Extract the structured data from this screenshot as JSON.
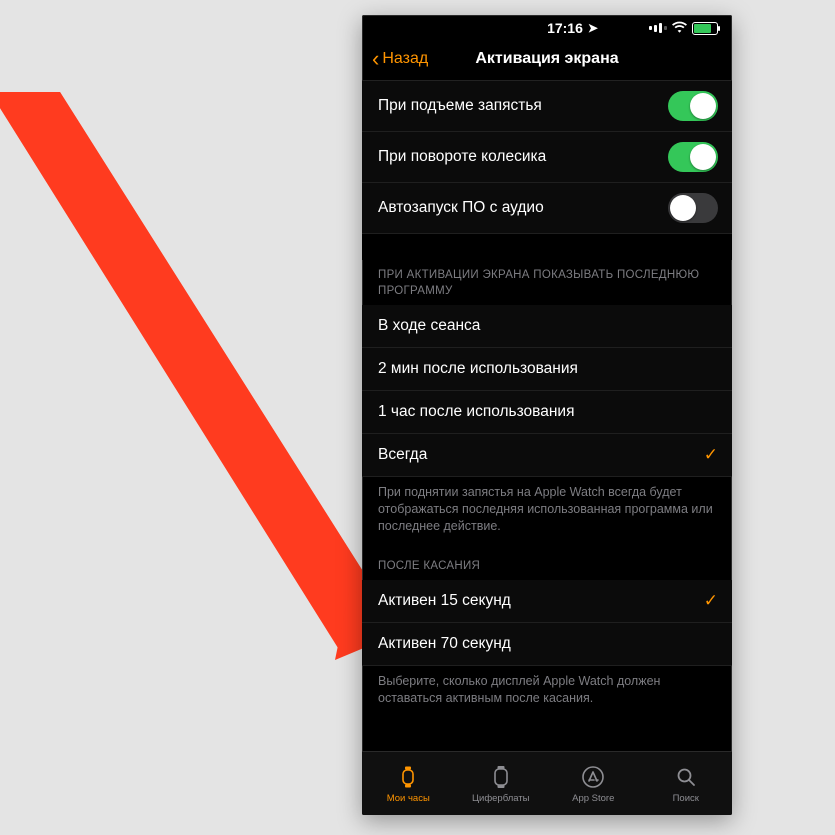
{
  "status": {
    "time": "17:16"
  },
  "nav": {
    "back_label": "Назад",
    "title": "Активация экрана"
  },
  "toggles": [
    {
      "label": "При подъеме запястья",
      "on": true
    },
    {
      "label": "При повороте колесика",
      "on": true
    },
    {
      "label": "Автозапуск ПО с аудио",
      "on": false
    }
  ],
  "section1": {
    "header": "ПРИ АКТИВАЦИИ ЭКРАНА ПОКАЗЫВАТЬ ПОСЛЕДНЮЮ ПРОГРАММУ",
    "options": [
      {
        "label": "В ходе сеанса",
        "selected": false
      },
      {
        "label": "2 мин после использования",
        "selected": false
      },
      {
        "label": "1 час после использования",
        "selected": false
      },
      {
        "label": "Всегда",
        "selected": true
      }
    ],
    "footer": "При поднятии запястья на Apple Watch всегда будет отображаться последняя использованная программа или последнее действие."
  },
  "section2": {
    "header": "ПОСЛЕ КАСАНИЯ",
    "options": [
      {
        "label": "Активен 15 секунд",
        "selected": true
      },
      {
        "label": "Активен 70 секунд",
        "selected": false
      }
    ],
    "footer": "Выберите, сколько дисплей Apple Watch должен оставаться активным после касания."
  },
  "tabs": [
    {
      "label": "Мои часы",
      "icon": "watch-icon",
      "active": true
    },
    {
      "label": "Циферблаты",
      "icon": "faces-icon",
      "active": false
    },
    {
      "label": "App Store",
      "icon": "appstore-icon",
      "active": false
    },
    {
      "label": "Поиск",
      "icon": "search-icon",
      "active": false
    }
  ],
  "colors": {
    "accent": "#ff9500",
    "toggle_on": "#34c759",
    "annotation": "#ff3b1f"
  }
}
